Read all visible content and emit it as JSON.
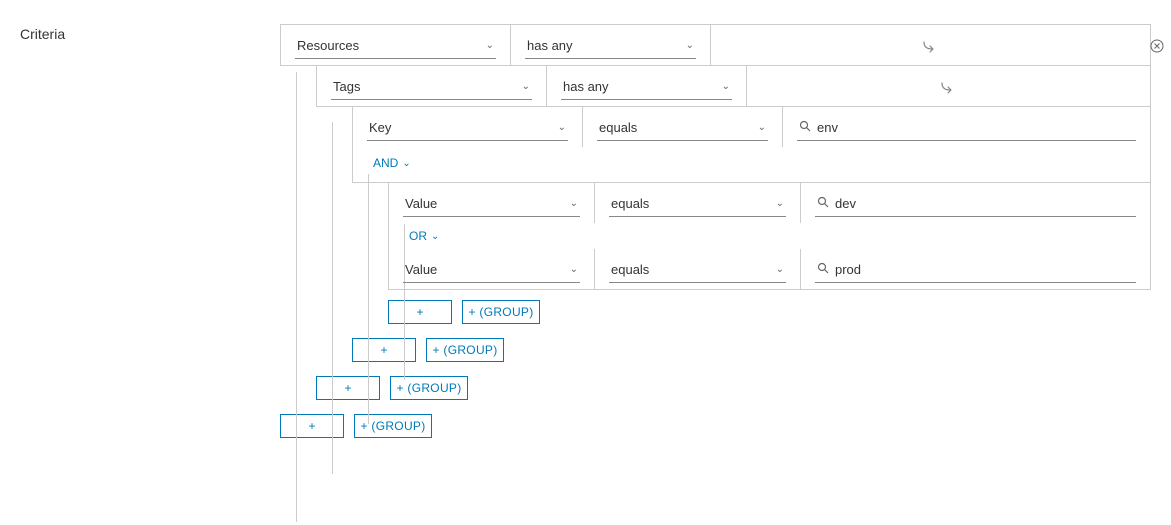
{
  "label": "Criteria",
  "rows": {
    "r0": {
      "field": "Resources",
      "op": "has any"
    },
    "r1": {
      "field": "Tags",
      "op": "has any"
    },
    "r2": {
      "field": "Key",
      "op": "equals",
      "value": "env"
    },
    "r3": {
      "field": "Value",
      "op": "equals",
      "value": "dev"
    },
    "r4": {
      "field": "Value",
      "op": "equals",
      "value": "prod"
    }
  },
  "logic": {
    "and": "AND",
    "or": "OR"
  },
  "buttons": {
    "plus": "+",
    "group": "+ (GROUP)"
  }
}
